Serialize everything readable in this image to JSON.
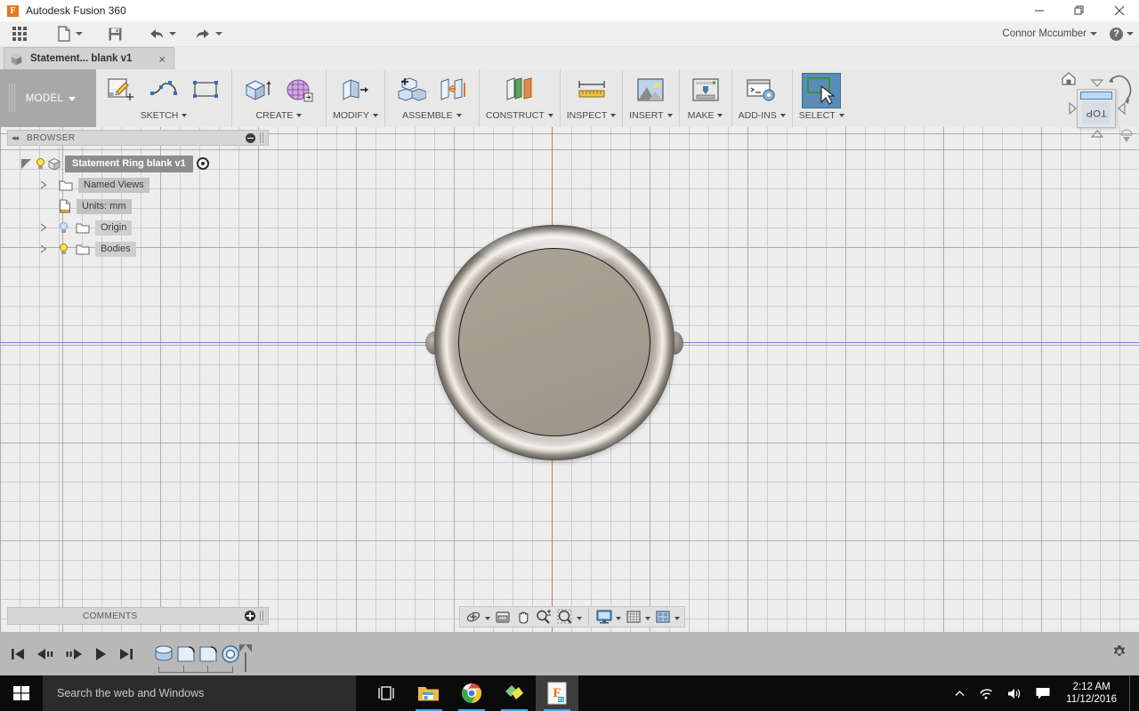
{
  "window": {
    "app_title": "Autodesk Fusion 360",
    "logo_letter": "F",
    "minimize": "minimize-button",
    "restore": "restore-button",
    "close": "close-button"
  },
  "quick_access": {
    "grid_menu": "show-data-panel",
    "new_label": "new-document",
    "save_label": "save",
    "undo_label": "undo",
    "redo_label": "redo",
    "user_name": "Connor Mccumber",
    "help_glyph": "?"
  },
  "document_tab": {
    "label": "Statement... blank v1",
    "close_glyph": "×"
  },
  "ribbon": {
    "workspace": "MODEL",
    "groups": [
      {
        "caption": "SKETCH",
        "icons": [
          "sketch-create-icon",
          "sketch-spline-icon",
          "sketch-rectangle-icon"
        ]
      },
      {
        "caption": "CREATE",
        "icons": [
          "extrude-icon",
          "form-icon"
        ]
      },
      {
        "caption": "MODIFY",
        "icons": [
          "press-pull-icon"
        ]
      },
      {
        "caption": "ASSEMBLE",
        "icons": [
          "new-component-icon",
          "joint-icon"
        ]
      },
      {
        "caption": "CONSTRUCT",
        "icons": [
          "offset-plane-icon"
        ]
      },
      {
        "caption": "INSPECT",
        "icons": [
          "measure-icon"
        ]
      },
      {
        "caption": "INSERT",
        "icons": [
          "insert-image-icon"
        ]
      },
      {
        "caption": "MAKE",
        "icons": [
          "3d-print-icon"
        ]
      },
      {
        "caption": "ADD-INS",
        "icons": [
          "scripts-addins-icon"
        ]
      },
      {
        "caption": "SELECT",
        "icons": [
          "select-window-icon"
        ],
        "active": true
      }
    ]
  },
  "browser": {
    "title": "BROWSER",
    "collapse_glyph": "◂◂",
    "root": {
      "label": "Statement Ring blank v1"
    },
    "items": [
      {
        "label": "Named Views",
        "icon": "folder-icon",
        "expandable": true,
        "bulb": "none"
      },
      {
        "label": "Units: mm",
        "icon": "document-icon",
        "expandable": false,
        "bulb": "none"
      },
      {
        "label": "Origin",
        "icon": "folder-icon",
        "expandable": true,
        "bulb": "off"
      },
      {
        "label": "Bodies",
        "icon": "folder-icon",
        "expandable": true,
        "bulb": "on"
      }
    ]
  },
  "comments": {
    "title": "COMMENTS",
    "add_glyph": "+"
  },
  "navigation_bar": {
    "buttons": [
      "orbit-icon",
      "look-at-icon",
      "pan-icon",
      "zoom-icon",
      "zoom-window-icon",
      "display-settings-icon",
      "grid-snaps-icon",
      "viewport-layout-icon"
    ]
  },
  "viewcube": {
    "face_label": "TOP",
    "home_icon": "home-icon",
    "rotate_icon": "rotate-arrows-icon"
  },
  "timeline": {
    "controls": [
      "go-to-beginning",
      "step-back",
      "step-forward",
      "play",
      "go-to-end"
    ],
    "features": [
      "extrude-feature-icon",
      "fillet-feature-icon",
      "fillet-feature-icon",
      "hole-feature-icon"
    ],
    "settings_icon": "timeline-settings-icon"
  },
  "canvas": {
    "model_name": "ring-blank-body",
    "view": "TOP",
    "axis_horizontal_color": "#7a7ad6",
    "axis_vertical_color": "#e06a6a",
    "background_color": "#ededed"
  },
  "taskbar": {
    "start": "windows-start-icon",
    "search_placeholder": "Search the web and Windows",
    "items": [
      {
        "name": "task-view-icon",
        "open": false
      },
      {
        "name": "file-explorer-icon",
        "open": true
      },
      {
        "name": "google-chrome-icon",
        "open": true
      },
      {
        "name": "sticky-notes-icon",
        "open": true
      },
      {
        "name": "fusion-360-icon",
        "open": true,
        "active": true
      }
    ],
    "tray": [
      "show-hidden-icons-chevron",
      "wifi-icon",
      "volume-icon",
      "action-center-icon"
    ],
    "time": "2:12 AM",
    "date": "11/12/2016"
  },
  "colors": {
    "accent_blue": "#5b8cb8",
    "ribbon_bg": "#e8e8e8",
    "panel_bg": "#d6d6d6",
    "timeline_bg": "#b8b8b8",
    "taskbar_bg": "#0b0b0b"
  }
}
